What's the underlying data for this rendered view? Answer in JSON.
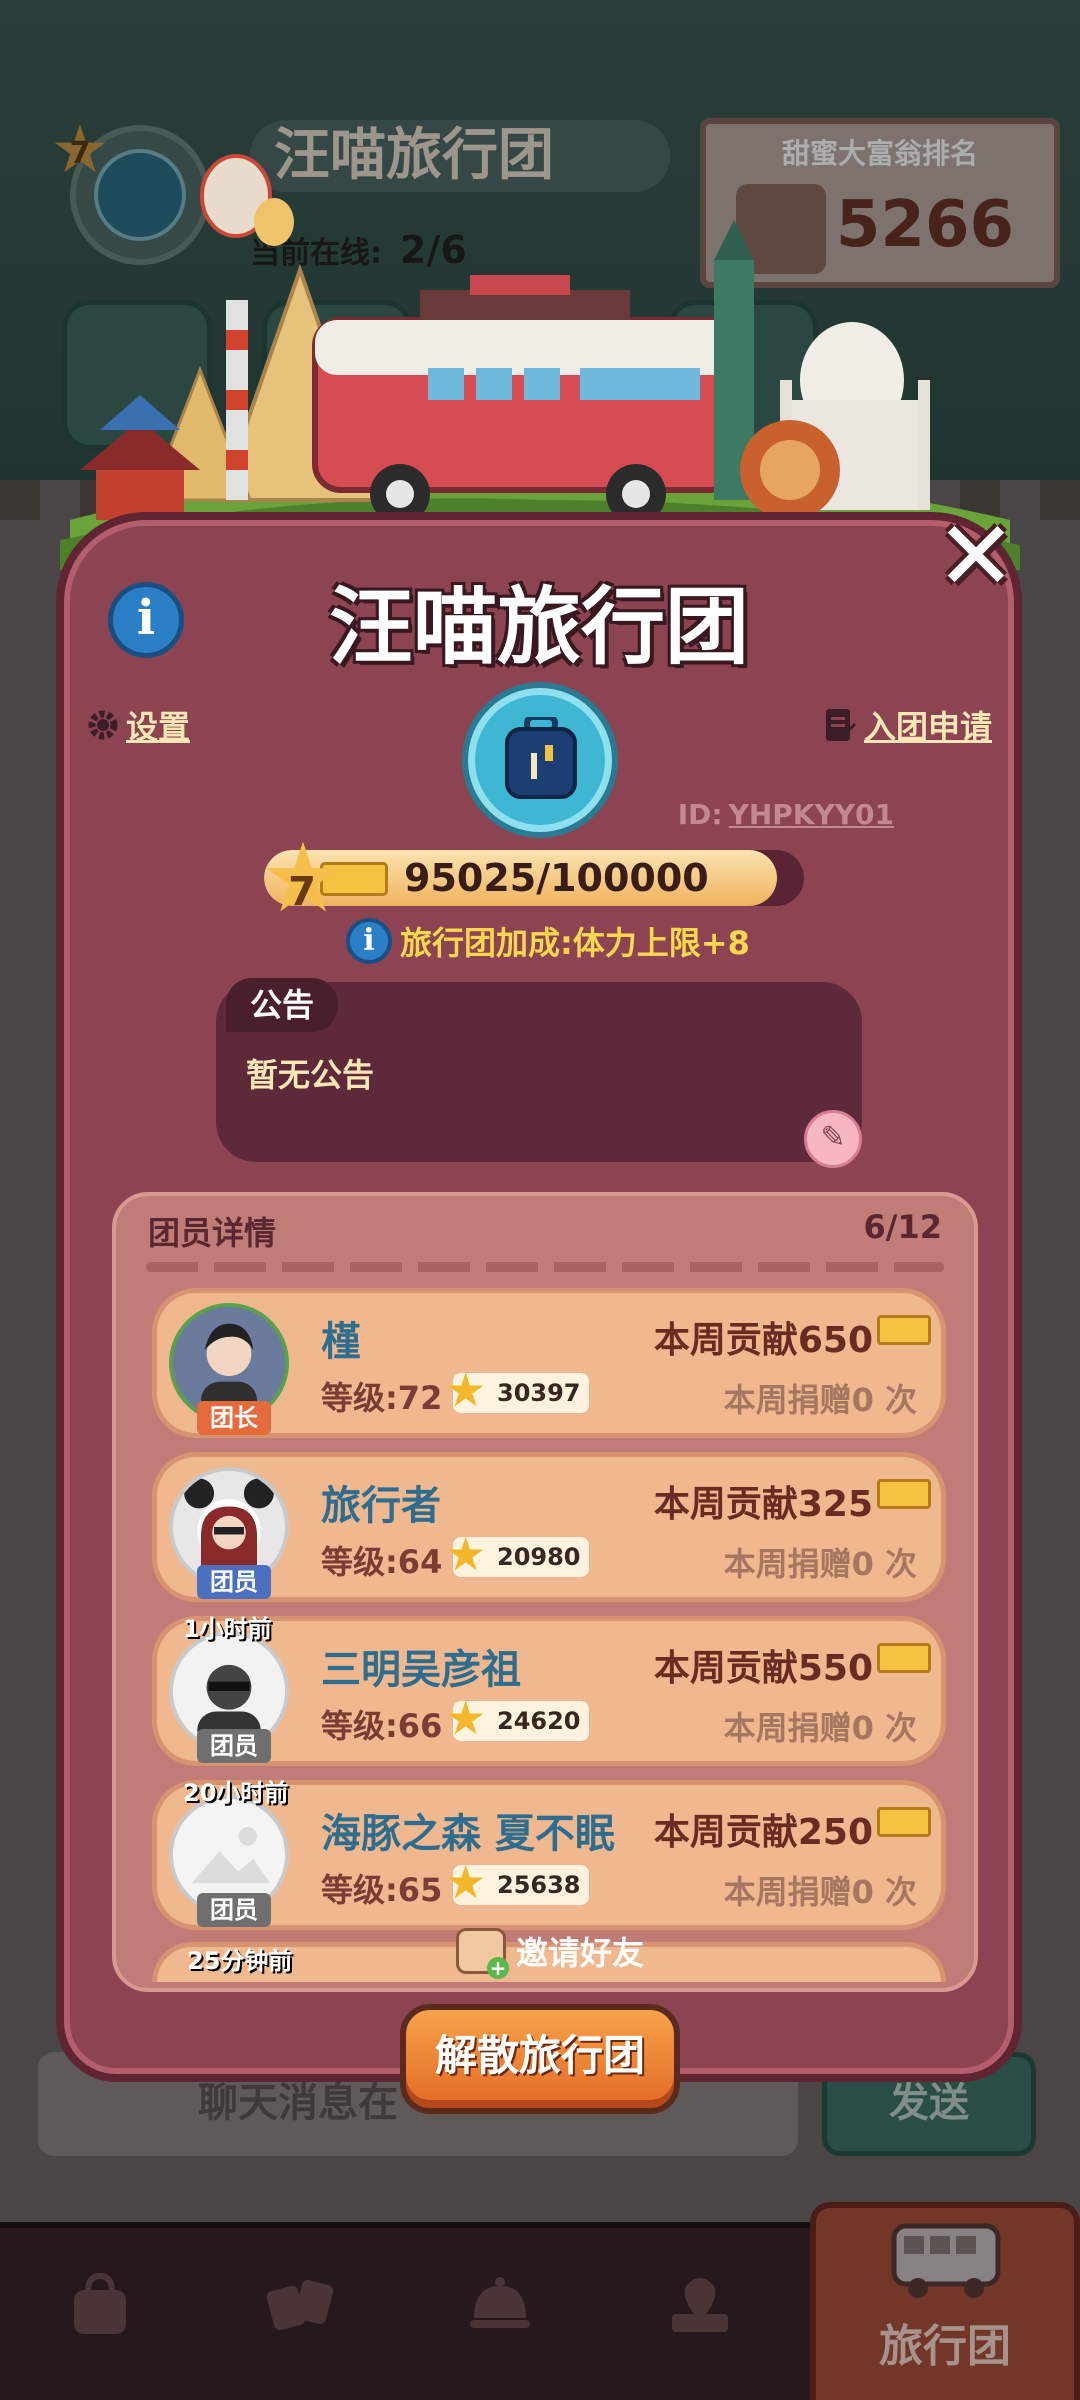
{
  "background": {
    "team_name": "汪喵旅行团",
    "online_label": "当前在线:",
    "online_value": "2/6",
    "level": "7",
    "ranking": {
      "title": "甜蜜大富翁排名",
      "value": "5266"
    },
    "chat_placeholder": "聊天消息在",
    "send_label": "发送"
  },
  "bottom_nav": {
    "items": [
      {
        "icon": "bag-icon"
      },
      {
        "icon": "cards-icon"
      },
      {
        "icon": "cloche-icon"
      },
      {
        "icon": "map-pin-icon"
      }
    ],
    "active_label": "旅行团",
    "active_icon": "bus-icon"
  },
  "modal": {
    "title": "汪喵旅行团",
    "info_icon": "info-icon",
    "close_icon": "close-icon",
    "settings_label": "设置",
    "apply_label": "入团申请",
    "team_id_label": "ID:",
    "team_id": "YHPKYY01",
    "level": "7",
    "exp_text": "95025/100000",
    "exp_progress": 0.95025,
    "bonus_text": "旅行团加成:体力上限+8",
    "notice": {
      "tag": "公告",
      "text": "暂无公告"
    },
    "members": {
      "header": "团员详情",
      "count": "6/12",
      "list": [
        {
          "name": "槿",
          "role": "团长",
          "role_type": "lead",
          "time": "",
          "level": "等级:72",
          "stars": "30397",
          "contribution": "本周贡献650",
          "donation": "本周捐赠0 次"
        },
        {
          "name": "旅行者",
          "role": "团员",
          "role_type": "mem",
          "time": "",
          "level": "等级:64",
          "stars": "20980",
          "contribution": "本周贡献325",
          "donation": "本周捐赠0 次"
        },
        {
          "name": "三明吴彦祖",
          "role": "团员",
          "role_type": "gray",
          "time": "1小时前",
          "level": "等级:66",
          "stars": "24620",
          "contribution": "本周贡献550",
          "donation": "本周捐赠0 次"
        },
        {
          "name": "海豚之森 夏不眠",
          "role": "团员",
          "role_type": "gray",
          "time": "20小时前",
          "level": "等级:65",
          "stars": "25638",
          "contribution": "本周贡献250",
          "donation": "本周捐赠0 次"
        }
      ],
      "next_time": "25分钟前",
      "invite_label": "邀请好友"
    },
    "dissolve_label": "解散旅行团"
  },
  "colors": {
    "modal_bg": "#8c4352",
    "member_row": "#f0b88e",
    "accent_orange": "#e26a25",
    "bonus_text": "#ffd84f"
  }
}
